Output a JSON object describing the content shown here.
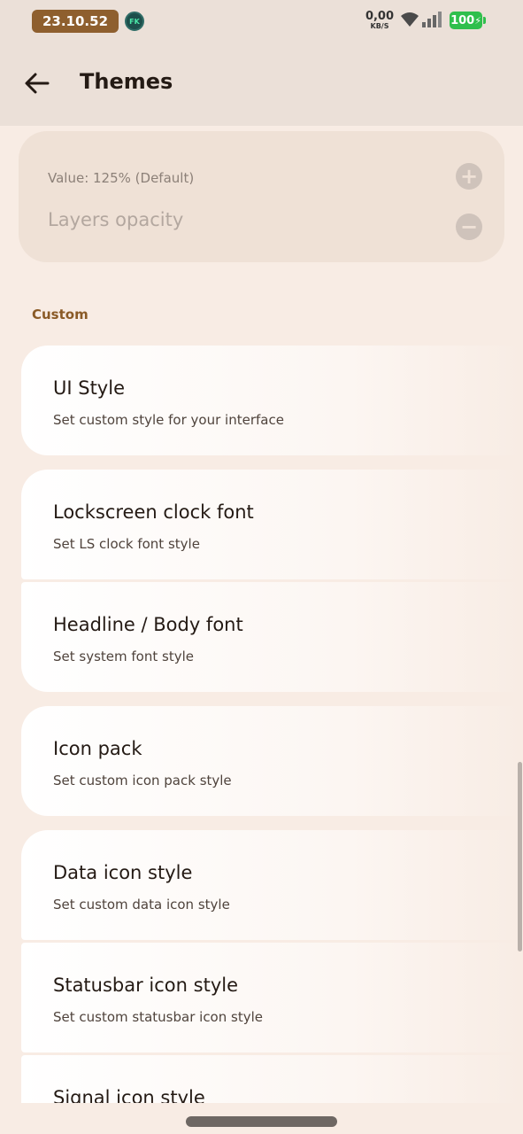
{
  "status": {
    "time": "23.10.52",
    "app_badge": "FK",
    "net_speed_value": "0,00",
    "net_speed_unit": "KB/S",
    "battery": "100"
  },
  "appbar": {
    "title": "Themes"
  },
  "slider": {
    "value_text": "Value: 125% (Default)",
    "label": "Layers opacity"
  },
  "section": {
    "label": "Custom"
  },
  "items": [
    {
      "title": "UI Style",
      "subtitle": "Set custom style for your interface"
    },
    {
      "title": "Lockscreen clock font",
      "subtitle": "Set LS clock font style"
    },
    {
      "title": "Headline / Body font",
      "subtitle": "Set system font style"
    },
    {
      "title": "Icon pack",
      "subtitle": "Set custom icon pack style"
    },
    {
      "title": "Data icon style",
      "subtitle": "Set custom data icon style"
    },
    {
      "title": "Statusbar icon style",
      "subtitle": "Set custom statusbar icon style"
    },
    {
      "title": "Signal icon style",
      "subtitle": ""
    }
  ],
  "colors": {
    "accent": "#8a5a26",
    "background": "#f8ece4",
    "battery": "#2fbf4c"
  }
}
